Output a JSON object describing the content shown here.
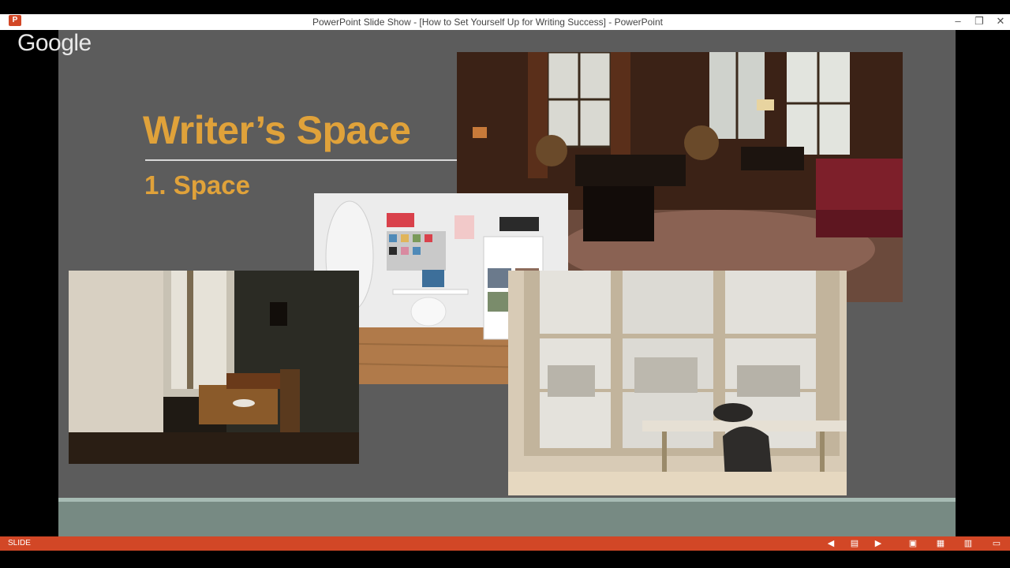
{
  "window": {
    "title": "PowerPoint Slide Show - [How to Set Yourself Up for Writing Success] - PowerPoint",
    "app_icon": "powerpoint-icon",
    "app_icon_glyph": "P",
    "controls": [
      {
        "name": "minimize-button",
        "icon": "minimize-icon",
        "glyph": "–"
      },
      {
        "name": "restore-button",
        "icon": "restore-icon",
        "glyph": "❐"
      },
      {
        "name": "close-button",
        "icon": "close-icon",
        "glyph": "✕"
      }
    ]
  },
  "overlay": {
    "logo_text": "Google"
  },
  "slide": {
    "title": "Writer’s Space",
    "subtitle": "1. Space",
    "colors": {
      "background": "#5c5c5c",
      "accent": "#e0a23a",
      "footer": "#778a83"
    },
    "images": [
      {
        "name": "library-room-photo",
        "description_icon": "photo"
      },
      {
        "name": "white-workspace-photo",
        "description_icon": "photo"
      },
      {
        "name": "dark-window-desk-photo",
        "description_icon": "photo"
      },
      {
        "name": "window-table-photo",
        "description_icon": "photo"
      }
    ]
  },
  "statusbar": {
    "label": "SLIDE",
    "color": "#d24726",
    "icons": [
      {
        "name": "previous-slide-button",
        "icon": "previous-icon",
        "glyph": "◀"
      },
      {
        "name": "slide-menu-button",
        "icon": "menu-icon",
        "glyph": "▤"
      },
      {
        "name": "next-slide-button",
        "icon": "next-icon",
        "glyph": "▶"
      },
      {
        "name": "normal-view-button",
        "icon": "normal-view-icon",
        "glyph": "▣"
      },
      {
        "name": "slide-sorter-button",
        "icon": "slide-sorter-icon",
        "glyph": "▦"
      },
      {
        "name": "reading-view-button",
        "icon": "reading-view-icon",
        "glyph": "▥"
      },
      {
        "name": "slideshow-button",
        "icon": "slideshow-icon",
        "glyph": "▭"
      }
    ]
  }
}
